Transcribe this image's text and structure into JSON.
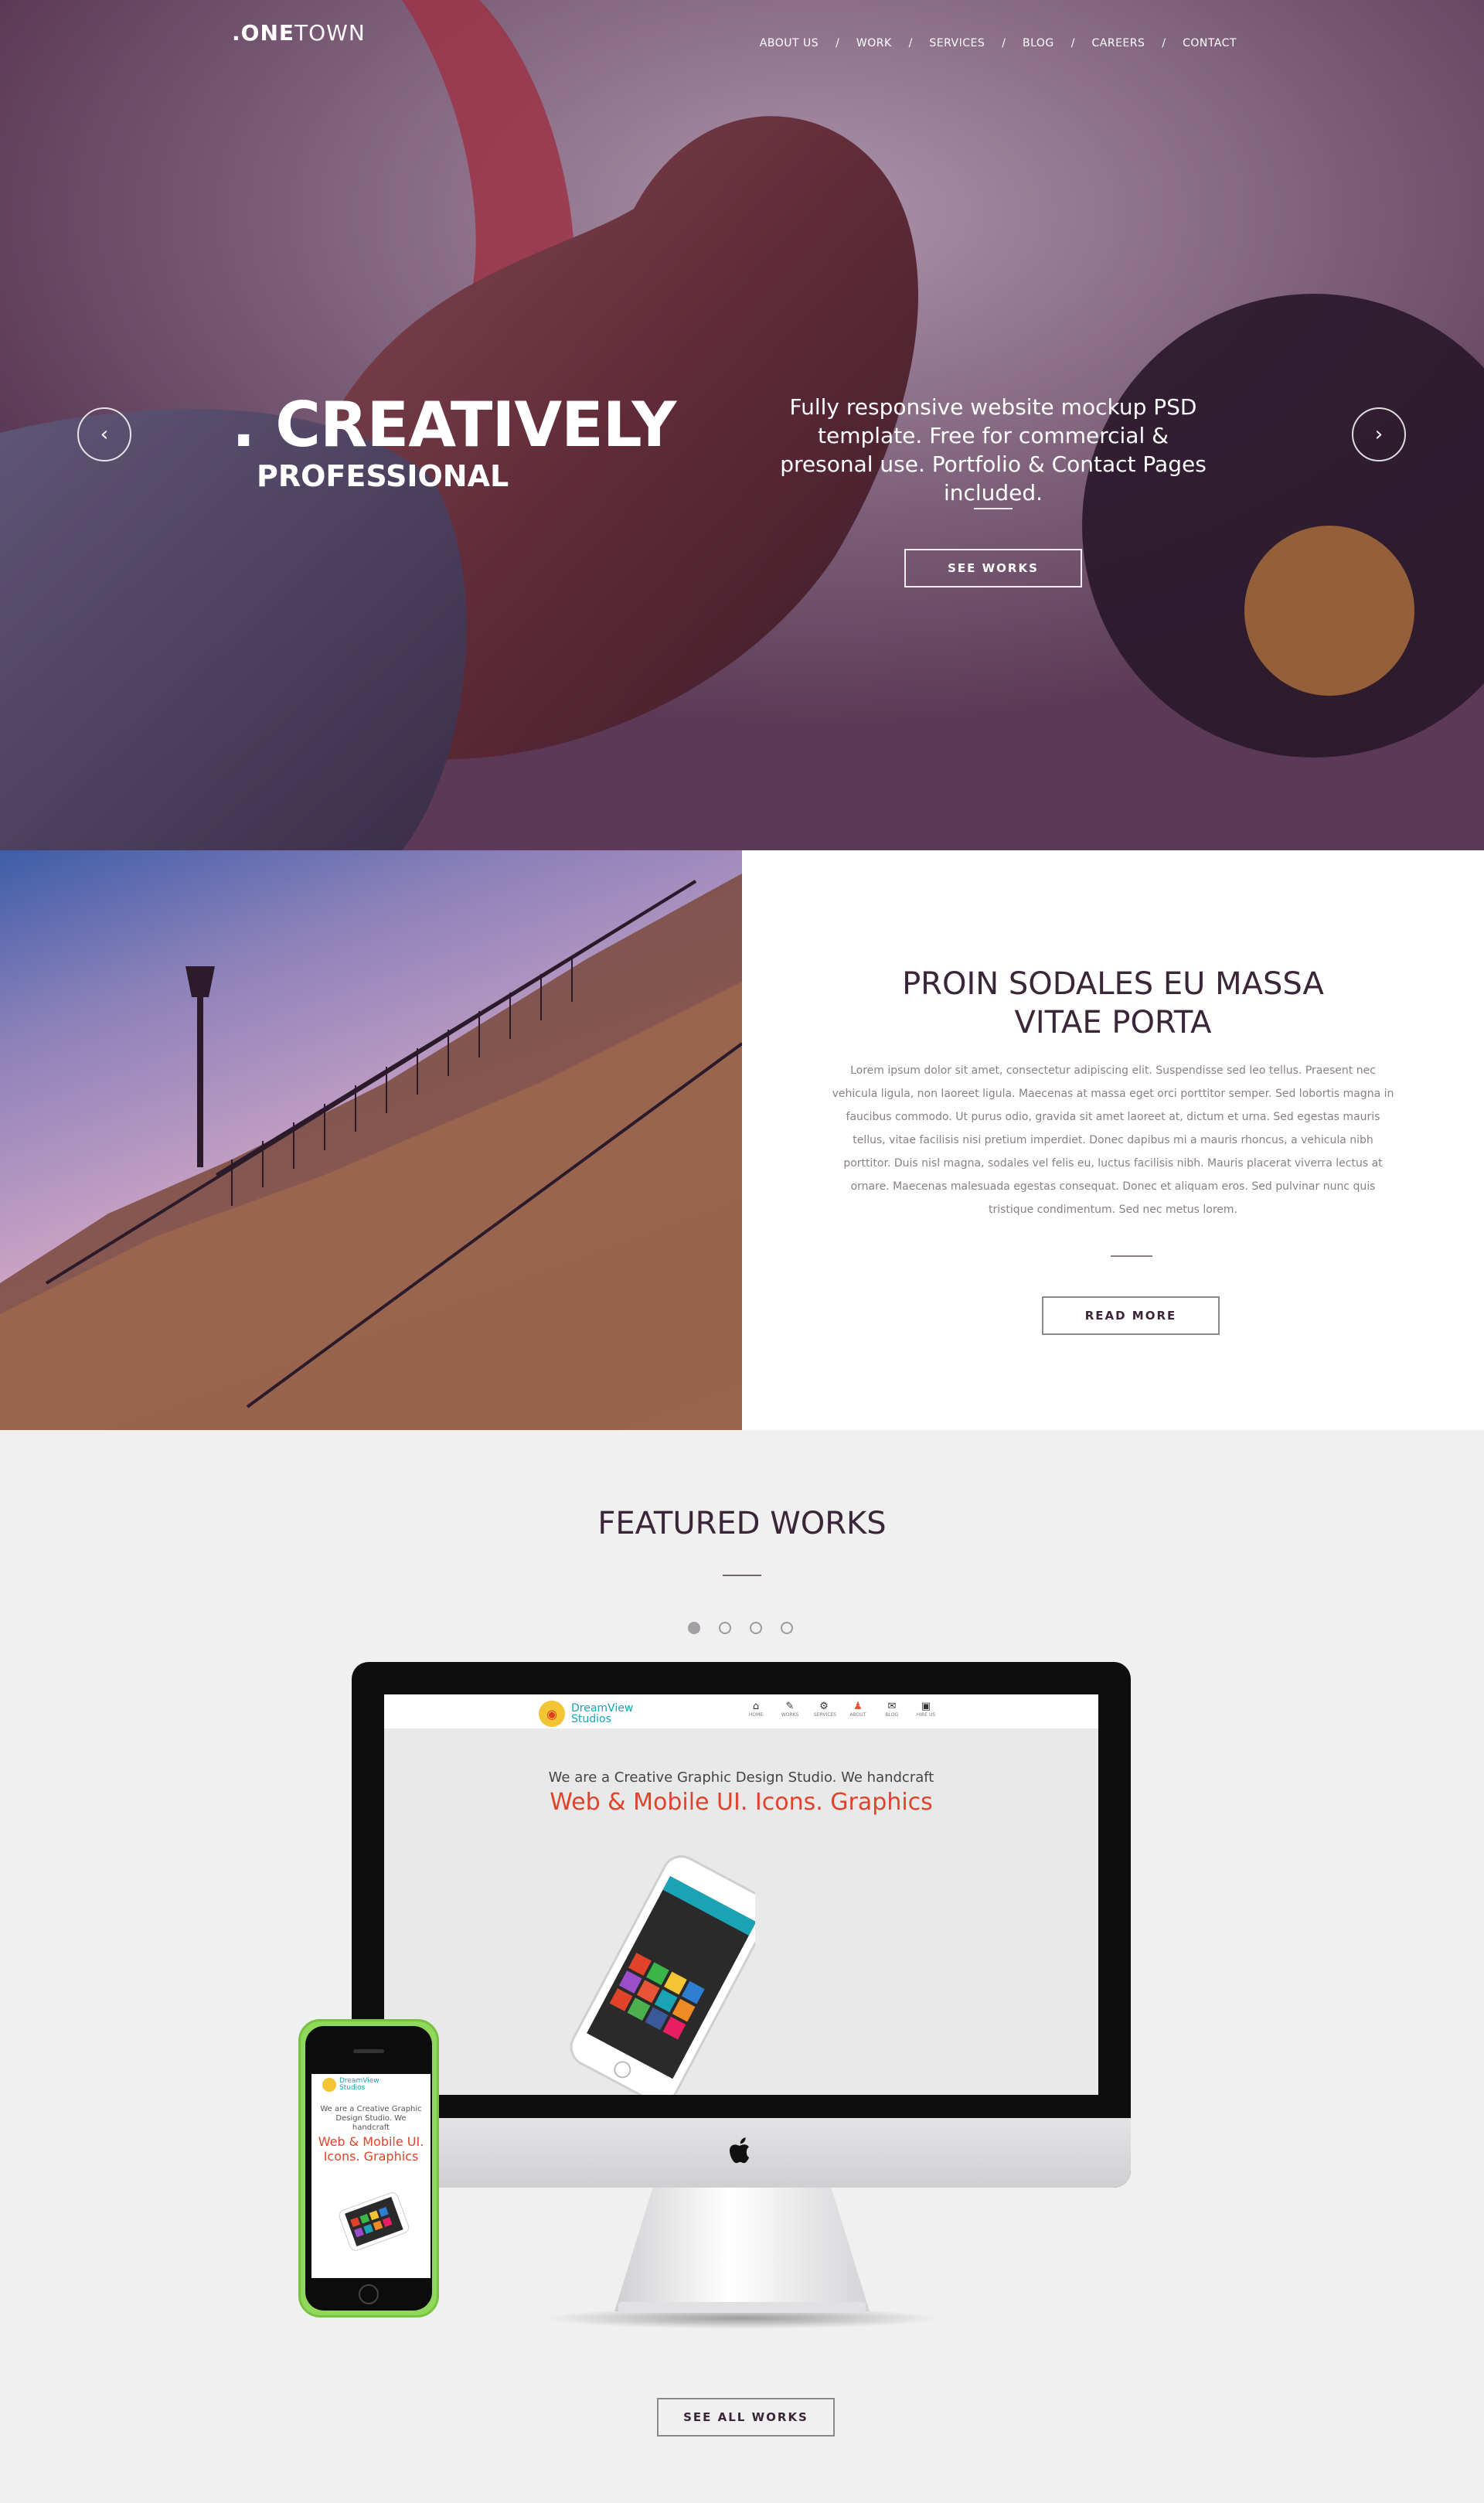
{
  "header": {
    "logo_dot": ".",
    "logo_bold": "ONE",
    "logo_thin": "TOWN",
    "nav": [
      "ABOUT US",
      "WORK",
      "SERVICES",
      "BLOG",
      "CAREERS",
      "CONTACT"
    ],
    "nav_separator": "/"
  },
  "hero": {
    "headline": ". CREATIVELY",
    "subheadline": "PROFESSIONAL",
    "tagline": "Fully responsive website mockup PSD template. Free for commercial & presonal use.  Portfolio & Contact Pages included.",
    "button": "SEE WORKS",
    "prev_icon": "chevron-left-icon",
    "next_icon": "chevron-right-icon"
  },
  "about": {
    "title_line1": "PROIN SODALES EU MASSA",
    "title_line2": "VITAE PORTA",
    "body": "Lorem ipsum dolor sit amet, consectetur adipiscing elit. Suspendisse sed leo tellus. Praesent nec vehicula ligula, non laoreet ligula. Maecenas at massa eget orci porttitor semper. Sed lobortis magna in faucibus commodo. Ut purus odio, gravida sit amet laoreet at, dictum et urna. Sed egestas mauris tellus, vitae facilisis nisi pretium imperdiet. Donec dapibus mi a mauris rhoncus, a vehicula nibh porttitor. Duis nisl magna, sodales vel felis eu, luctus facilisis nibh. Mauris placerat viverra lectus at ornare. Maecenas malesuada egestas consequat. Donec et aliquam eros. Sed pulvinar nunc quis tristique condimentum. Sed nec metus lorem.",
    "button": "READ MORE"
  },
  "featured": {
    "title": "FEATURED WORKS",
    "slider_dots": 4,
    "active_dot": 1,
    "button": "SEE ALL WORKS"
  },
  "mockup": {
    "brand_line1": "DreamView",
    "brand_line2": "Studios",
    "nav": [
      "HOME",
      "WORKS",
      "SERVICES",
      "ABOUT",
      "BLOG",
      "HIRE US"
    ],
    "active_nav": "ABOUT",
    "line1": "We are a Creative Graphic Design Studio. We handcraft",
    "line2": "Web & Mobile UI. Icons. Graphics",
    "phone_line1": "We are a Creative Graphic Design Studio. We handcraft",
    "phone_line2": "Web & Mobile UI. Icons. Graphics"
  },
  "colors": {
    "accent_red": "#e1432a",
    "teal": "#1aa3b4",
    "heading": "#3a2638"
  }
}
